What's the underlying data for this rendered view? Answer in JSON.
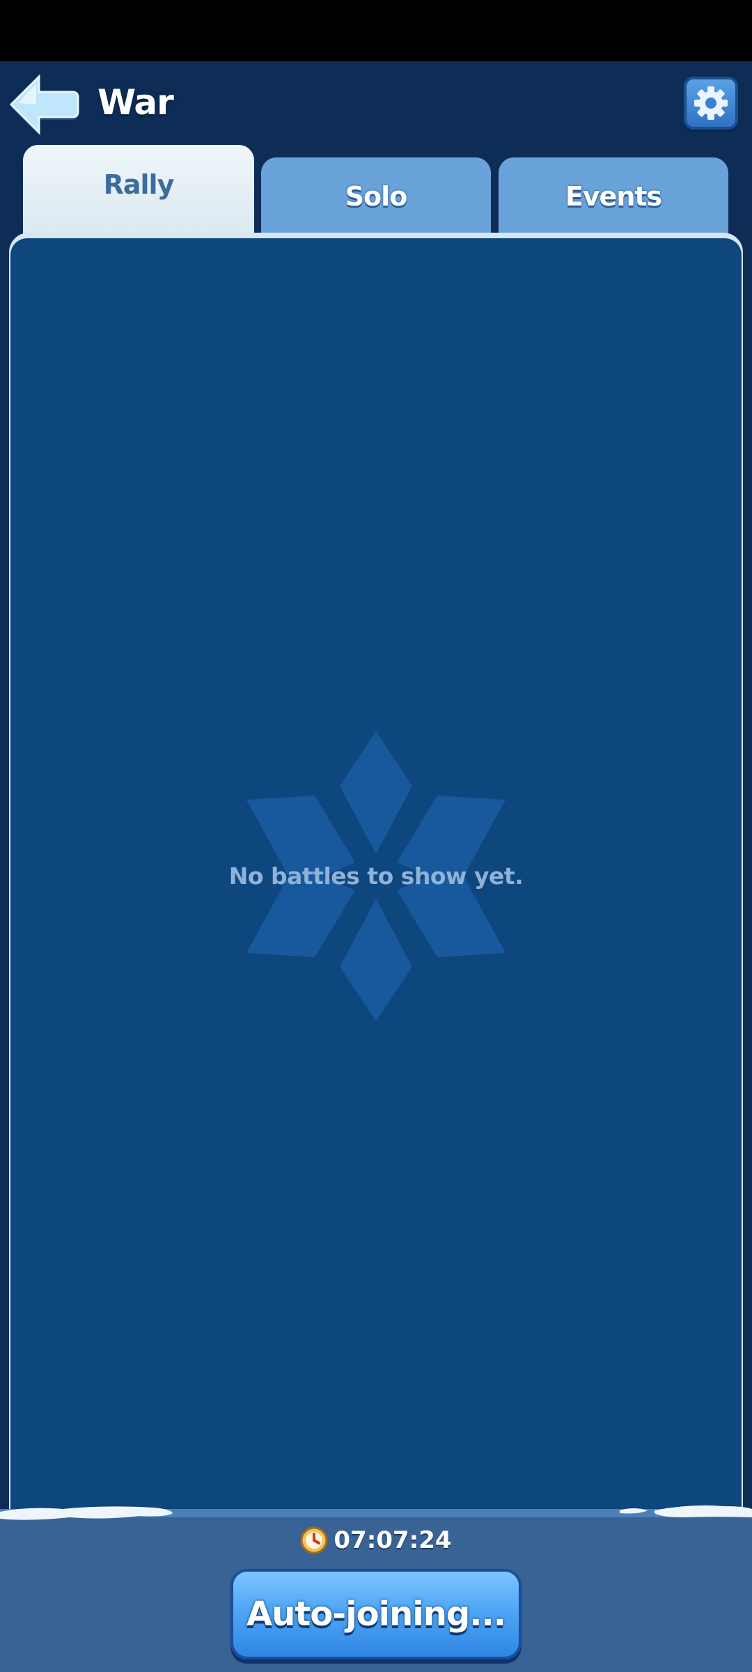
{
  "header": {
    "title": "War"
  },
  "tabs": [
    {
      "label": "Rally",
      "active": true
    },
    {
      "label": "Solo",
      "active": false
    },
    {
      "label": "Events",
      "active": false
    }
  ],
  "panel": {
    "empty_message": "No battles to show yet."
  },
  "footer": {
    "timer": "07:07:24",
    "auto_join_label": "Auto-joining..."
  },
  "icons": {
    "back": "back-arrow-icon",
    "settings": "gear-icon",
    "empty": "snowflake-icon",
    "timer": "clock-icon"
  },
  "colors": {
    "background": "#0d2d57",
    "panel": "#0e467e",
    "tab_active": "#e3eef5",
    "tab_inactive": "#6aa2da",
    "button": "#4fa6f5"
  }
}
